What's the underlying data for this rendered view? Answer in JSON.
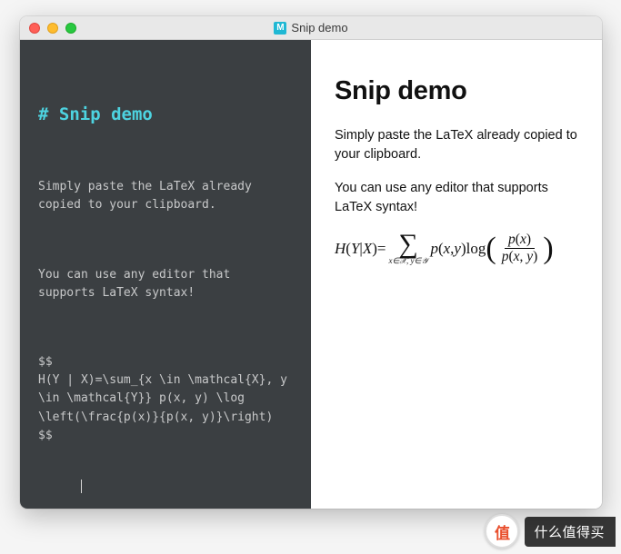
{
  "window": {
    "title": "Snip demo",
    "app_icon_letter": "M"
  },
  "editor": {
    "heading": "# Snip demo",
    "para1": "Simply paste the LaTeX already copied to your clipboard.",
    "para2": "You can use any editor that supports LaTeX syntax!",
    "latex": "$$\nH(Y | X)=\\sum_{x \\in \\mathcal{X}, y \\in \\mathcal{Y}} p(x, y) \\log \\left(\\frac{p(x)}{p(x, y)}\\right)\n$$"
  },
  "preview": {
    "heading": "Snip demo",
    "para1": "Simply paste the LaTeX already copied to your clipboard.",
    "para2": "You can use any editor that supports LaTeX syntax!",
    "math": {
      "lhs_H": "H",
      "lhs_Y": "Y",
      "lhs_bar": "|",
      "lhs_X": "X",
      "eq": "=",
      "sigma": "∑",
      "sum_sub": "x∈𝒳, y∈𝒴",
      "p1": "p",
      "args1_x": "x",
      "args1_c": ", ",
      "args1_y": "y",
      "log": " log",
      "frac_num_p": "p",
      "frac_num_x": "x",
      "frac_den_p": "p",
      "frac_den_x": "x",
      "frac_den_c": ", ",
      "frac_den_y": "y"
    }
  },
  "watermark": {
    "badge": "值",
    "text": "什么值得买"
  }
}
